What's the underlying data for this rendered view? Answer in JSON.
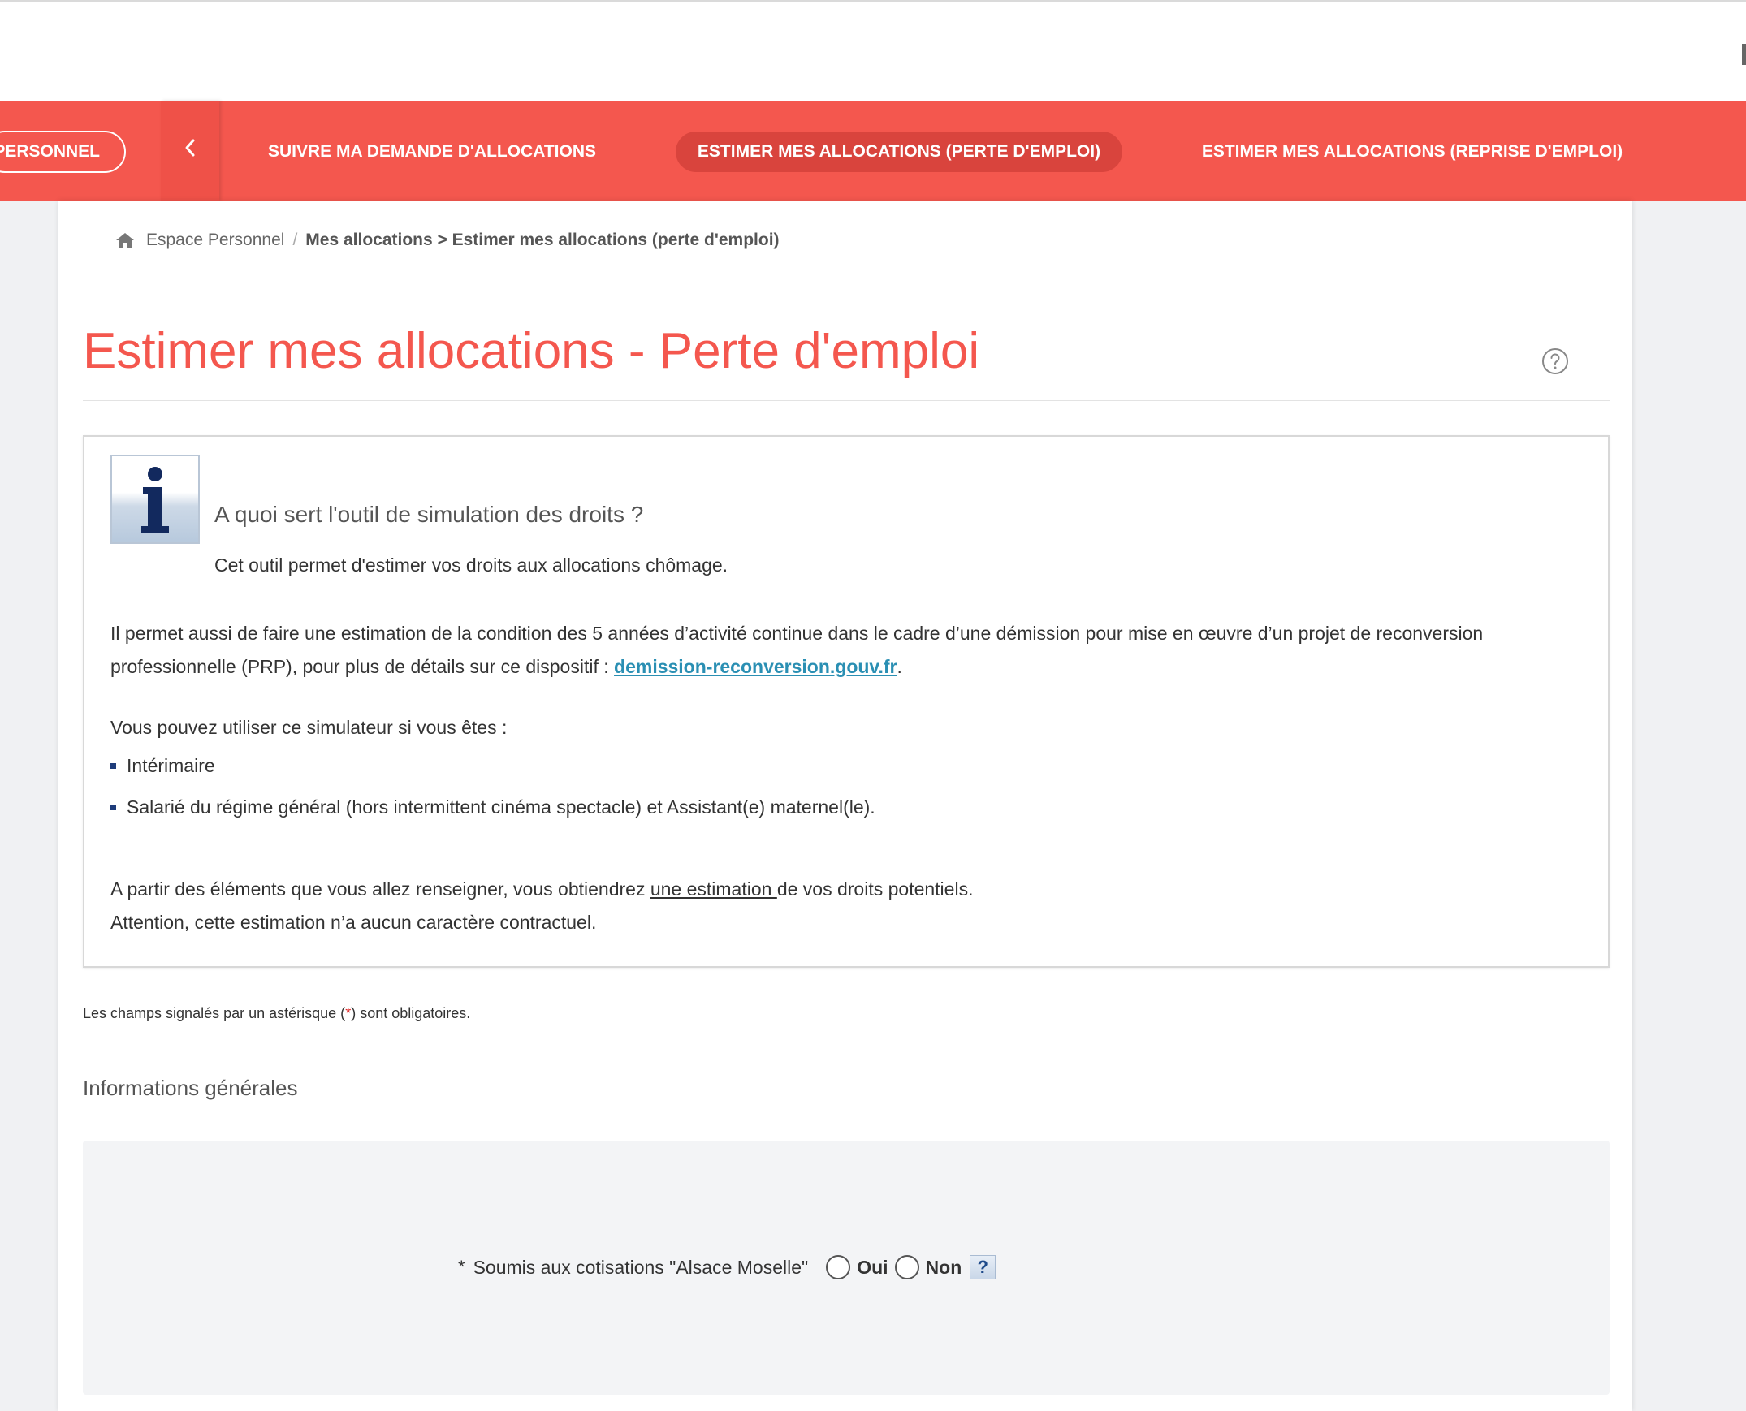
{
  "nav": {
    "personnel_label": "PERSONNEL",
    "items": [
      {
        "label": "SUIVRE MA DEMANDE D'ALLOCATIONS"
      },
      {
        "label": "ESTIMER MES ALLOCATIONS (PERTE D'EMPLOI)",
        "active": true
      },
      {
        "label": "ESTIMER MES ALLOCATIONS (REPRISE D'EMPLOI)"
      }
    ],
    "accent_color": "#f4574e"
  },
  "breadcrumb": {
    "home_label": "Espace Personnel",
    "separator": "/",
    "current": "Mes allocations > Estimer mes allocations (perte d'emploi)"
  },
  "page": {
    "title": "Estimer mes allocations - Perte d'emploi",
    "help_icon": "question-circle-icon"
  },
  "info": {
    "heading": "A quoi sert l'outil de simulation des droits ?",
    "subheading": "Cet outil permet d'estimer vos droits aux allocations chômage.",
    "paragraph_before_link": "Il permet aussi de faire une estimation de la condition des 5 années d’activité continue dans le cadre d’une démission pour mise en œuvre d’un projet de reconversion professionnelle (PRP), pour plus de détails sur ce dispositif : ",
    "link_text": "demission-reconversion.gouv.fr",
    "paragraph_after_link": ".",
    "intro": "Vous pouvez utiliser ce simulateur si vous êtes :",
    "list": [
      "Intérimaire",
      "Salarié du régime général (hors intermittent cinéma spectacle) et Assistant(e) maternel(le)."
    ],
    "footer_prefix": "A partir des éléments que vous allez renseigner, vous obtiendrez ",
    "footer_underlined": "une estimation ",
    "footer_suffix": "de vos droits potentiels.",
    "footer_line2": "Attention, cette estimation n’a aucun caractère contractuel."
  },
  "form": {
    "required_note_prefix": "Les champs signalés par un astérisque (",
    "required_note_star": "*",
    "required_note_suffix": ") sont obligatoires.",
    "section_title": "Informations générales",
    "alsace": {
      "star": "*",
      "label": "Soumis aux cotisations \"Alsace Moselle\"",
      "option_yes": "Oui",
      "option_no": "Non",
      "help": "?"
    }
  }
}
